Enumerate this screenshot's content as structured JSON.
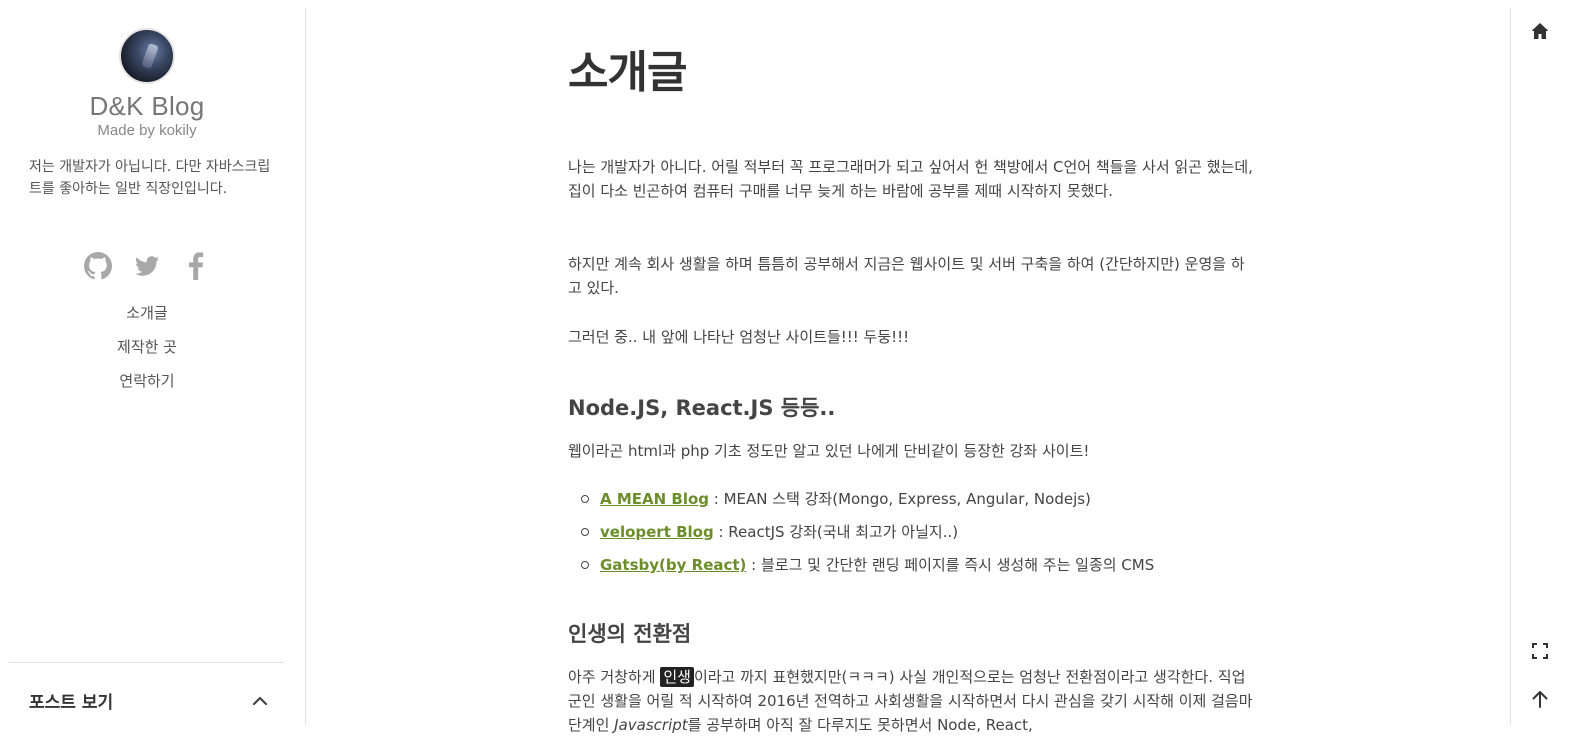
{
  "sidebar": {
    "blog_title": "D&K Blog",
    "blog_subtitle": "Made by kokily",
    "description": "저는 개발자가 아닙니다. 다만 자바스크립트를 좋아하는 일반 직장인입니다.",
    "social_icons": [
      "github-icon",
      "twitter-icon",
      "facebook-icon"
    ],
    "menu": [
      {
        "label": "소개글"
      },
      {
        "label": "제작한 곳"
      },
      {
        "label": "연락하기"
      }
    ],
    "posts_toggle_label": "포스트 보기"
  },
  "main": {
    "title": "소개글",
    "intro_p1": "나는 개발자가 아니다. 어릴 적부터 꼭 프로그래머가 되고 싶어서 헌 책방에서 C언어 책들을 사서 읽곤 했는데, 집이 다소 빈곤하여 컴퓨터 구매를 너무 늦게 하는 바람에 공부를 제때 시작하지 못했다.",
    "intro_p2": "하지만 계속 회사 생활을 하며 틈틈히 공부해서 지금은 웹사이트 및 서버 구축을 하여 (간단하지만) 운영을 하고 있다.",
    "intro_p3": "그러던 중.. 내 앞에 나타난 엄청난 사이트들!!! 두둥!!!",
    "section1_heading": "Node.JS, React.JS 등등..",
    "section1_text": "웹이라곤 html과 php 기초 정도만 알고 있던 나에게 단비같이 등장한 강좌 사이트!",
    "links": [
      {
        "name": "A MEAN Blog",
        "desc": " : MEAN 스택 강좌(Mongo, Express, Angular, Nodejs)"
      },
      {
        "name": "velopert Blog",
        "desc": " : ReactJS 강좌(국내 최고가 아닐지..)"
      },
      {
        "name": "Gatsby(by React)",
        "desc": " : 블로그 및 간단한 랜딩 페이지를 즉시 생성해 주는 일종의 CMS"
      }
    ],
    "section2_heading": "인생의 전환점",
    "section2_pre": "아주 거창하게 ",
    "section2_highlight": "인생",
    "section2_mid": "이라고 까지 표현했지만(ㅋㅋㅋ) 사실 개인적으로는 엄청난 전환점이라고 생각한다. 직업군인 생활을 어릴 적 시작하여 2016년 전역하고 사회생활을 시작하면서 다시 관심을 갖기 시작해 이제 걸음마 단계인 ",
    "section2_em": "Javascript",
    "section2_post": "를 공부하며 아직 잘 다루지도 못하면서 Node, React,"
  },
  "rail": {
    "icons": [
      "home-icon",
      "fullscreen-icon",
      "arrow-up-icon"
    ]
  },
  "colors": {
    "link": "#6c8e2a",
    "text": "#444444",
    "divider": "#e2e2e2"
  }
}
